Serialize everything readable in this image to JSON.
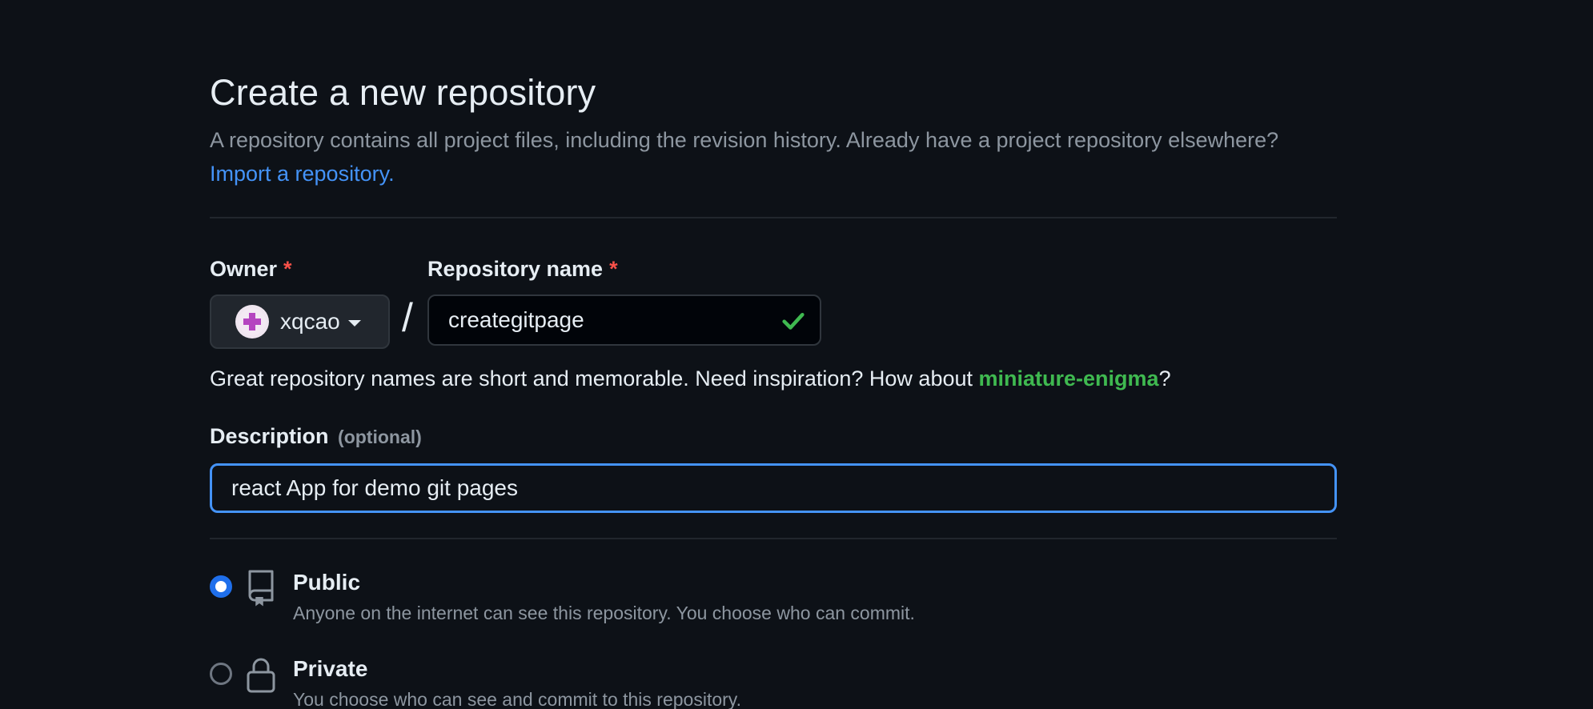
{
  "header": {
    "title": "Create a new repository",
    "subtitle_text": "A repository contains all project files, including the revision history. Already have a project repository elsewhere?",
    "import_link": "Import a repository."
  },
  "owner": {
    "label": "Owner",
    "required_mark": "*",
    "value": "xqcao",
    "icon": "avatar-icon"
  },
  "separator": "/",
  "repo_name": {
    "label": "Repository name",
    "required_mark": "*",
    "value": "creategitpage",
    "status_icon": "check-icon"
  },
  "hint": {
    "text_before": "Great repository names are short and memorable. Need inspiration? How about",
    "suggestion": "miniature-enigma",
    "text_after": "?"
  },
  "description": {
    "label": "Description",
    "optional": "(optional)",
    "value": "react App for demo git pages"
  },
  "visibility": [
    {
      "title": "Public",
      "desc": "Anyone on the internet can see this repository. You choose who can commit.",
      "icon": "repo-icon",
      "selected": true
    },
    {
      "title": "Private",
      "desc": "You choose who can see and commit to this repository.",
      "icon": "lock-icon",
      "selected": false
    }
  ],
  "colors": {
    "background": "#0d1117",
    "accent": "#4493f8",
    "success": "#3fb950",
    "danger": "#f85149"
  }
}
